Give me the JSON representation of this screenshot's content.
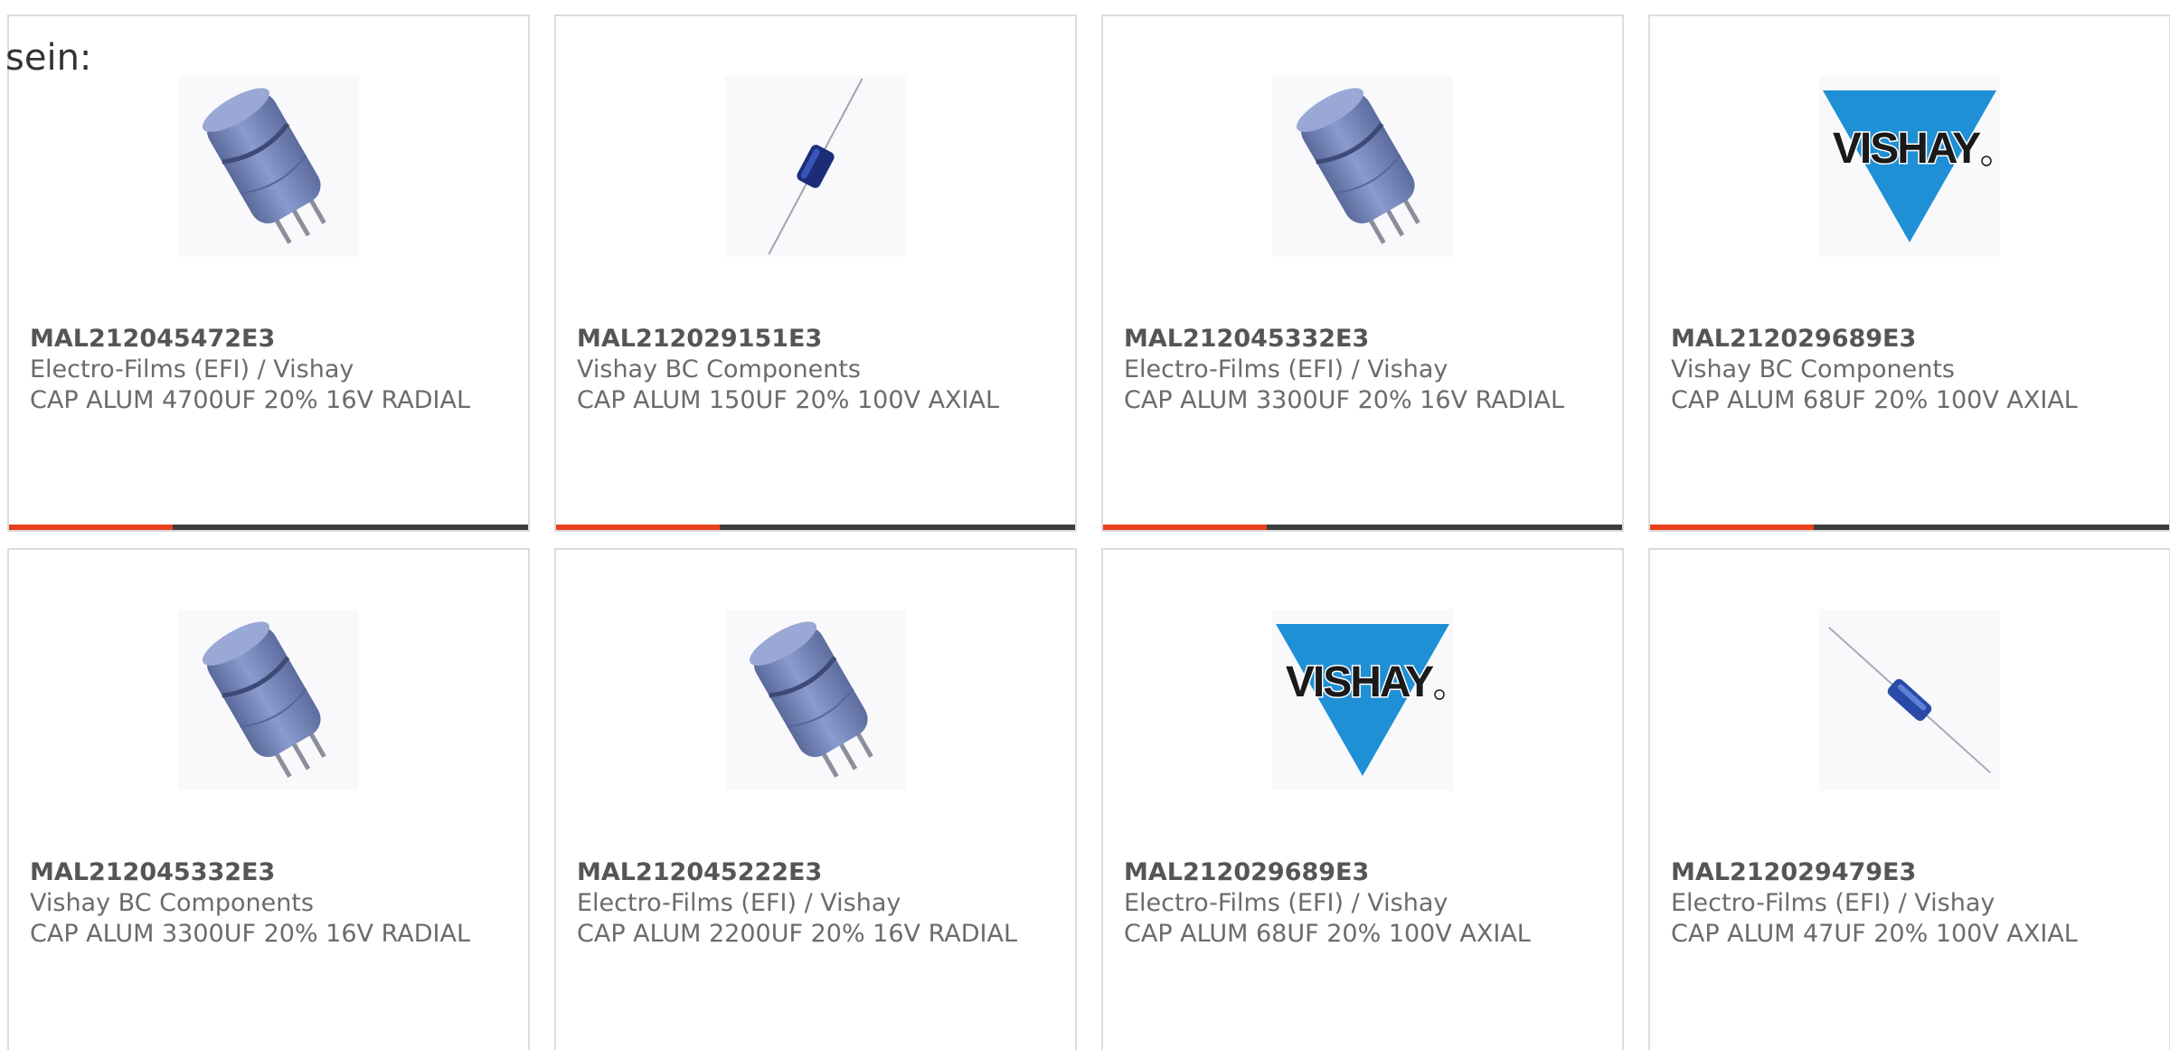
{
  "intro_text": "sein:",
  "colors": {
    "accent": "#e8401c",
    "bar_dark": "#3d3d3d",
    "card_border": "#dcdcdc",
    "text": "#6b6b6b",
    "vishay_blue": "#1f8fd6"
  },
  "products": [
    {
      "part_number": "MAL212045472E3",
      "manufacturer": "Electro-Films (EFI) / Vishay",
      "description": "CAP ALUM 4700UF 20% 16V RADIAL",
      "image": "radial-capacitor-image"
    },
    {
      "part_number": "MAL212029151E3",
      "manufacturer": "Vishay BC Components",
      "description": "CAP ALUM 150UF 20% 100V AXIAL",
      "image": "axial-capacitor-image"
    },
    {
      "part_number": "MAL212045332E3",
      "manufacturer": "Electro-Films (EFI) / Vishay",
      "description": "CAP ALUM 3300UF 20% 16V RADIAL",
      "image": "radial-capacitor-image"
    },
    {
      "part_number": "MAL212029689E3",
      "manufacturer": "Vishay BC Components",
      "description": "CAP ALUM 68UF 20% 100V AXIAL",
      "image": "vishay-logo"
    },
    {
      "part_number": "MAL212045332E3",
      "manufacturer": "Vishay BC Components",
      "description": "CAP ALUM 3300UF 20% 16V RADIAL",
      "image": "radial-capacitor-image"
    },
    {
      "part_number": "MAL212045222E3",
      "manufacturer": "Electro-Films (EFI) / Vishay",
      "description": "CAP ALUM 2200UF 20% 16V RADIAL",
      "image": "radial-capacitor-image"
    },
    {
      "part_number": "MAL212029689E3",
      "manufacturer": "Electro-Films (EFI) / Vishay",
      "description": "CAP ALUM 68UF 20% 100V AXIAL",
      "image": "vishay-logo"
    },
    {
      "part_number": "MAL212029479E3",
      "manufacturer": "Electro-Films (EFI) / Vishay",
      "description": "CAP ALUM 47UF 20% 100V AXIAL",
      "image": "axial-capacitor-image"
    }
  ],
  "vishay_logo_text": "VISHAY"
}
